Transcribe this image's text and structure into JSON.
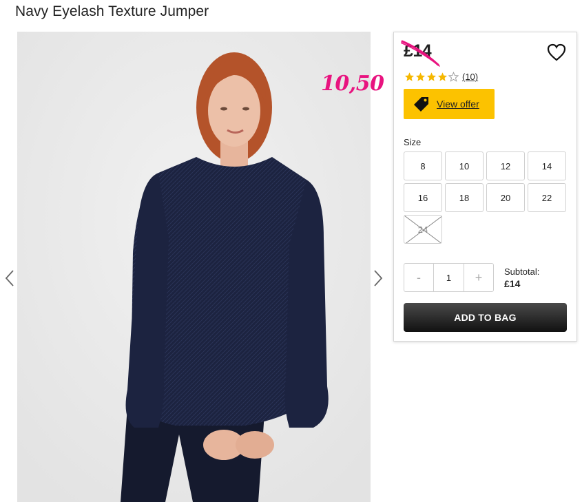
{
  "product": {
    "title": "Navy Eyelash Texture Jumper",
    "price": "£14",
    "annotation_price": "10,50",
    "rating": 4,
    "rating_max": 5,
    "review_count": "(10)"
  },
  "offer": {
    "label": "View offer"
  },
  "sizes": {
    "label": "Size",
    "options": [
      "8",
      "10",
      "12",
      "14",
      "16",
      "18",
      "20",
      "22",
      "24"
    ],
    "unavailable": [
      "24"
    ]
  },
  "quantity": {
    "minus": "-",
    "value": "1",
    "plus": "+"
  },
  "subtotal": {
    "label": "Subtotal:",
    "value": "£14"
  },
  "actions": {
    "add_to_bag": "ADD TO BAG"
  },
  "colors": {
    "accent_yellow": "#fcc200",
    "star_yellow": "#f5b700",
    "annotation_pink": "#e8137f",
    "jumper_navy": "#1c2340"
  },
  "icons": [
    "chevron-left-icon",
    "chevron-right-icon",
    "heart-icon",
    "star-icon",
    "price-tag-icon"
  ]
}
